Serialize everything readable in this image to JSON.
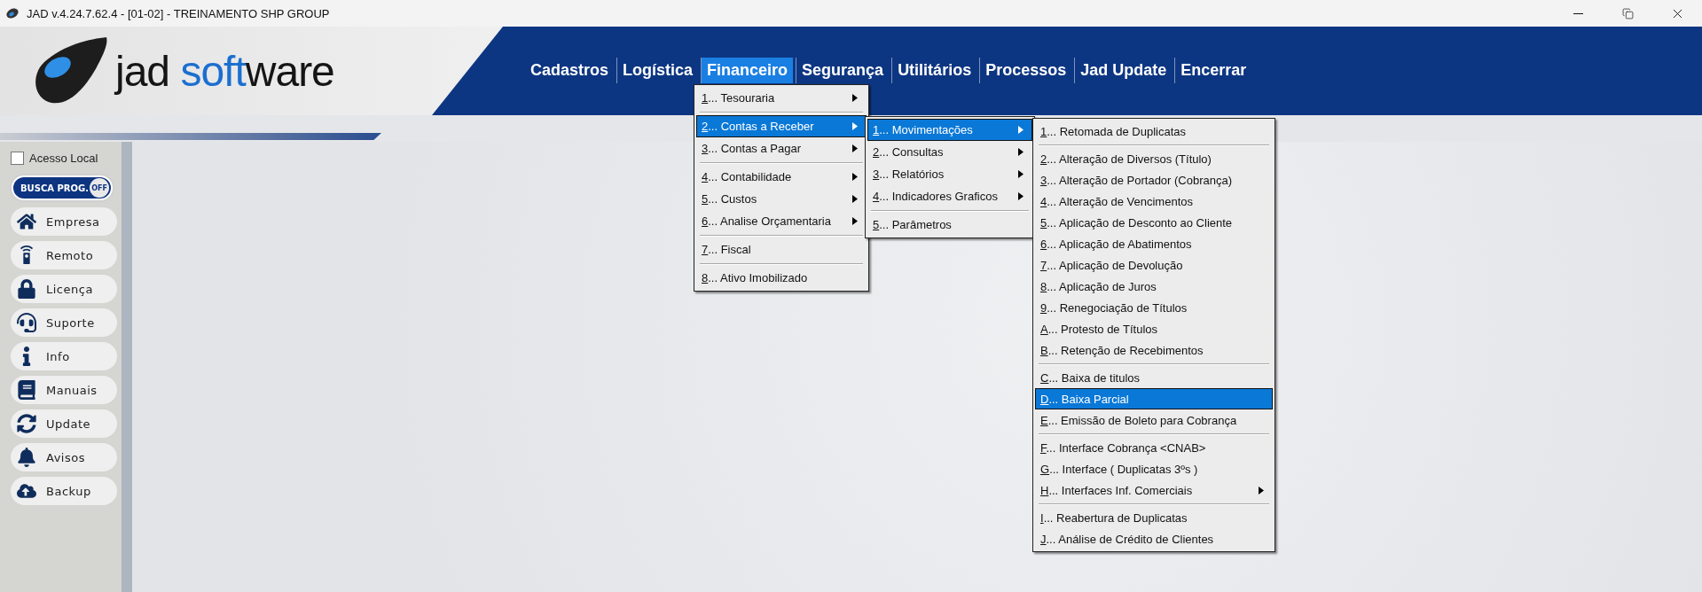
{
  "window": {
    "title": "JAD v.4.24.7.62.4 - [01-02] - TREINAMENTO SHP GROUP"
  },
  "logo": {
    "parts": [
      {
        "text": "jad ",
        "accent": false
      },
      {
        "text": "soft",
        "accent": true
      },
      {
        "text": "ware",
        "accent": false
      }
    ]
  },
  "menu_bar": [
    {
      "label": "Cadastros",
      "selected": false
    },
    {
      "label": "Logística",
      "selected": false
    },
    {
      "label": "Financeiro",
      "selected": true
    },
    {
      "label": "Segurança",
      "selected": false
    },
    {
      "label": "Utilitários",
      "selected": false
    },
    {
      "label": "Processos",
      "selected": false
    },
    {
      "label": "Jad Update",
      "selected": false
    },
    {
      "label": "Encerrar",
      "selected": false
    }
  ],
  "sidebar": {
    "local_access": {
      "label": "Acesso Local",
      "checked": false
    },
    "search_toggle": {
      "label": "BUSCA PROG.",
      "state": "OFF",
      "on": false
    },
    "buttons": [
      {
        "label": "Empresa",
        "kind": "home"
      },
      {
        "label": "Remoto",
        "kind": "remote"
      },
      {
        "label": "Licença",
        "kind": "lock"
      },
      {
        "label": "Suporte",
        "kind": "headset"
      },
      {
        "label": "Info",
        "kind": "info"
      },
      {
        "label": "Manuais",
        "kind": "book"
      },
      {
        "label": "Update",
        "kind": "sync"
      },
      {
        "label": "Avisos",
        "kind": "bell"
      },
      {
        "label": "Backup",
        "kind": "cloud"
      }
    ]
  },
  "menus": [
    {
      "items": [
        {
          "key": "1",
          "label": "... Tesouraria",
          "has_submenu": true,
          "separator_before": false,
          "selected": false
        },
        {
          "key": "2",
          "label": "... Contas a Receber",
          "has_submenu": true,
          "separator_before": true,
          "selected": true
        },
        {
          "key": "3",
          "label": "... Contas a Pagar",
          "has_submenu": true,
          "separator_before": false,
          "selected": false
        },
        {
          "key": "4",
          "label": "... Contabilidade",
          "has_submenu": true,
          "separator_before": true,
          "selected": false
        },
        {
          "key": "5",
          "label": "... Custos",
          "has_submenu": true,
          "separator_before": false,
          "selected": false
        },
        {
          "key": "6",
          "label": "... Analise Orçamentaria",
          "has_submenu": true,
          "separator_before": false,
          "selected": false
        },
        {
          "key": "7",
          "label": "... Fiscal",
          "has_submenu": false,
          "separator_before": true,
          "selected": false
        },
        {
          "key": "8",
          "label": "... Ativo Imobilizado",
          "has_submenu": false,
          "separator_before": true,
          "selected": false
        }
      ]
    },
    {
      "items": [
        {
          "key": "1",
          "label": "... Movimentações",
          "has_submenu": true,
          "separator_before": false,
          "selected": true
        },
        {
          "key": "2",
          "label": "... Consultas",
          "has_submenu": true,
          "separator_before": false,
          "selected": false
        },
        {
          "key": "3",
          "label": "... Relatórios",
          "has_submenu": true,
          "separator_before": false,
          "selected": false
        },
        {
          "key": "4",
          "label": "... Indicadores Graficos",
          "has_submenu": true,
          "separator_before": false,
          "selected": false
        },
        {
          "key": "5",
          "label": "... Parâmetros",
          "has_submenu": false,
          "separator_before": true,
          "selected": false
        }
      ]
    },
    {
      "items": [
        {
          "key": "1",
          "label": "... Retomada de Duplicatas",
          "has_submenu": false,
          "separator_before": false,
          "selected": false
        },
        {
          "key": "2",
          "label": "... Alteração de Diversos (Título)",
          "has_submenu": false,
          "separator_before": true,
          "selected": false
        },
        {
          "key": "3",
          "label": "... Alteração de Portador (Cobrança)",
          "has_submenu": false,
          "separator_before": false,
          "selected": false
        },
        {
          "key": "4",
          "label": "... Alteração de Vencimentos",
          "has_submenu": false,
          "separator_before": false,
          "selected": false
        },
        {
          "key": "5",
          "label": "... Aplicação de Desconto ao Cliente",
          "has_submenu": false,
          "separator_before": false,
          "selected": false
        },
        {
          "key": "6",
          "label": "... Aplicação de Abatimentos",
          "has_submenu": false,
          "separator_before": false,
          "selected": false
        },
        {
          "key": "7",
          "label": "... Aplicação de Devolução",
          "has_submenu": false,
          "separator_before": false,
          "selected": false
        },
        {
          "key": "8",
          "label": "... Aplicação de Juros",
          "has_submenu": false,
          "separator_before": false,
          "selected": false
        },
        {
          "key": "9",
          "label": "... Renegociação de Títulos",
          "has_submenu": false,
          "separator_before": false,
          "selected": false
        },
        {
          "key": "A",
          "label": "... Protesto de Títulos",
          "has_submenu": false,
          "separator_before": false,
          "selected": false
        },
        {
          "key": "B",
          "label": "... Retenção de Recebimentos",
          "has_submenu": false,
          "separator_before": false,
          "selected": false
        },
        {
          "key": "C",
          "label": "... Baixa de titulos",
          "has_submenu": false,
          "separator_before": true,
          "selected": false
        },
        {
          "key": "D",
          "label": "... Baixa Parcial",
          "has_submenu": false,
          "separator_before": false,
          "selected": true
        },
        {
          "key": "E",
          "label": "... Emissão de Boleto para Cobrança",
          "has_submenu": false,
          "separator_before": false,
          "selected": false
        },
        {
          "key": "F",
          "label": "... Interface Cobrança <CNAB>",
          "has_submenu": false,
          "separator_before": true,
          "selected": false
        },
        {
          "key": "G",
          "label": "... Interface ( Duplicatas 3ºs )",
          "has_submenu": false,
          "separator_before": false,
          "selected": false
        },
        {
          "key": "H",
          "label": "... Interfaces Inf. Comerciais",
          "has_submenu": true,
          "separator_before": false,
          "selected": false
        },
        {
          "key": "I",
          "label": "... Reabertura de Duplicatas",
          "has_submenu": false,
          "separator_before": true,
          "selected": false
        },
        {
          "key": "J",
          "label": "... Análise de Crédito de Clientes",
          "has_submenu": false,
          "separator_before": false,
          "selected": false
        }
      ]
    }
  ]
}
